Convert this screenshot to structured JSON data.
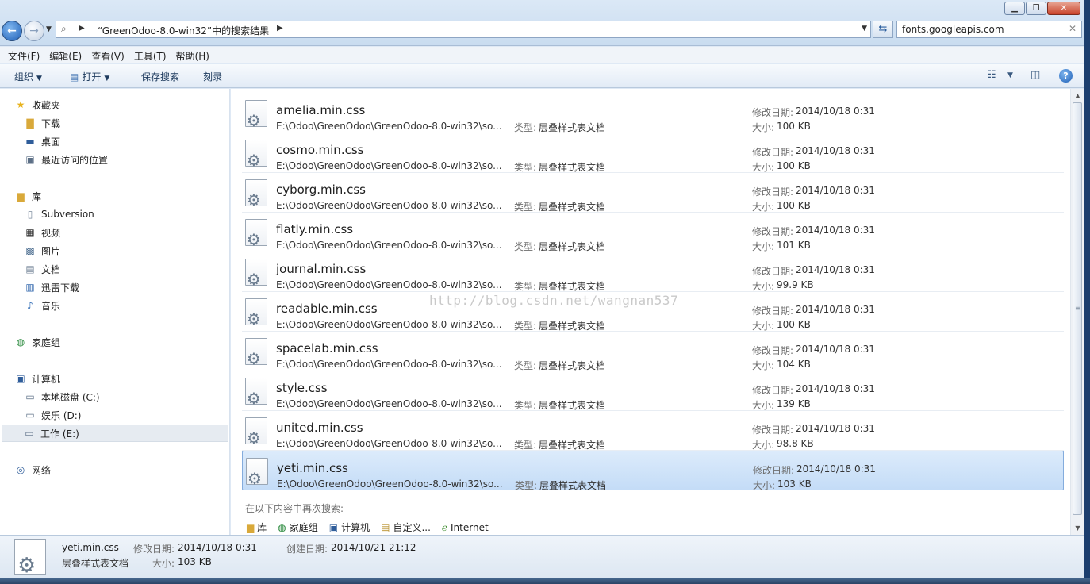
{
  "window": {
    "controls": {
      "minimize": "▁",
      "maximize": "❐",
      "close": "✕"
    }
  },
  "address": {
    "path": "“GreenOdoo-8.0-win32”中的搜索结果",
    "search_value": "fonts.googleapis.com"
  },
  "menu": [
    "文件(F)",
    "编辑(E)",
    "查看(V)",
    "工具(T)",
    "帮助(H)"
  ],
  "commands": {
    "organize": "组织",
    "open": "打开",
    "save_search": "保存搜索",
    "burn": "刻录"
  },
  "sidebar": {
    "favorites": {
      "label": "收藏夹",
      "items": [
        "下载",
        "桌面",
        "最近访问的位置"
      ]
    },
    "libraries": {
      "label": "库",
      "items": [
        "Subversion",
        "视频",
        "图片",
        "文档",
        "迅雷下载",
        "音乐"
      ]
    },
    "homegroup": "家庭组",
    "computer": {
      "label": "计算机",
      "items": [
        "本地磁盘 (C:)",
        "娱乐 (D:)",
        "工作 (E:)"
      ]
    },
    "network": "网络"
  },
  "labels": {
    "modified": "修改日期:",
    "size": "大小:",
    "type": "类型:",
    "created": "创建日期:"
  },
  "files": [
    {
      "name": "amelia.min.css",
      "path": "E:\\Odoo\\GreenOdoo\\GreenOdoo-8.0-win32\\so...",
      "type": "层叠样式表文档",
      "modified": "2014/10/18 0:31",
      "size": "100 KB"
    },
    {
      "name": "cosmo.min.css",
      "path": "E:\\Odoo\\GreenOdoo\\GreenOdoo-8.0-win32\\so...",
      "type": "层叠样式表文档",
      "modified": "2014/10/18 0:31",
      "size": "100 KB"
    },
    {
      "name": "cyborg.min.css",
      "path": "E:\\Odoo\\GreenOdoo\\GreenOdoo-8.0-win32\\so...",
      "type": "层叠样式表文档",
      "modified": "2014/10/18 0:31",
      "size": "100 KB"
    },
    {
      "name": "flatly.min.css",
      "path": "E:\\Odoo\\GreenOdoo\\GreenOdoo-8.0-win32\\so...",
      "type": "层叠样式表文档",
      "modified": "2014/10/18 0:31",
      "size": "101 KB"
    },
    {
      "name": "journal.min.css",
      "path": "E:\\Odoo\\GreenOdoo\\GreenOdoo-8.0-win32\\so...",
      "type": "层叠样式表文档",
      "modified": "2014/10/18 0:31",
      "size": "99.9 KB"
    },
    {
      "name": "readable.min.css",
      "path": "E:\\Odoo\\GreenOdoo\\GreenOdoo-8.0-win32\\so...",
      "type": "层叠样式表文档",
      "modified": "2014/10/18 0:31",
      "size": "100 KB"
    },
    {
      "name": "spacelab.min.css",
      "path": "E:\\Odoo\\GreenOdoo\\GreenOdoo-8.0-win32\\so...",
      "type": "层叠样式表文档",
      "modified": "2014/10/18 0:31",
      "size": "104 KB"
    },
    {
      "name": "style.css",
      "path": "E:\\Odoo\\GreenOdoo\\GreenOdoo-8.0-win32\\so...",
      "type": "层叠样式表文档",
      "modified": "2014/10/18 0:31",
      "size": "139 KB"
    },
    {
      "name": "united.min.css",
      "path": "E:\\Odoo\\GreenOdoo\\GreenOdoo-8.0-win32\\so...",
      "type": "层叠样式表文档",
      "modified": "2014/10/18 0:31",
      "size": "98.8 KB"
    },
    {
      "name": "yeti.min.css",
      "path": "E:\\Odoo\\GreenOdoo\\GreenOdoo-8.0-win32\\so...",
      "type": "层叠样式表文档",
      "modified": "2014/10/18 0:31",
      "size": "103 KB"
    }
  ],
  "selected_index": 9,
  "research": {
    "label": "在以下内容中再次搜索:",
    "items": [
      "库",
      "家庭组",
      "计算机",
      "自定义...",
      "Internet"
    ]
  },
  "watermark": "http://blog.csdn.net/wangnan537",
  "details": {
    "name": "yeti.min.css",
    "type": "层叠样式表文档",
    "modified": "2014/10/18 0:31",
    "size": "103 KB",
    "created": "2014/10/21 21:12"
  }
}
